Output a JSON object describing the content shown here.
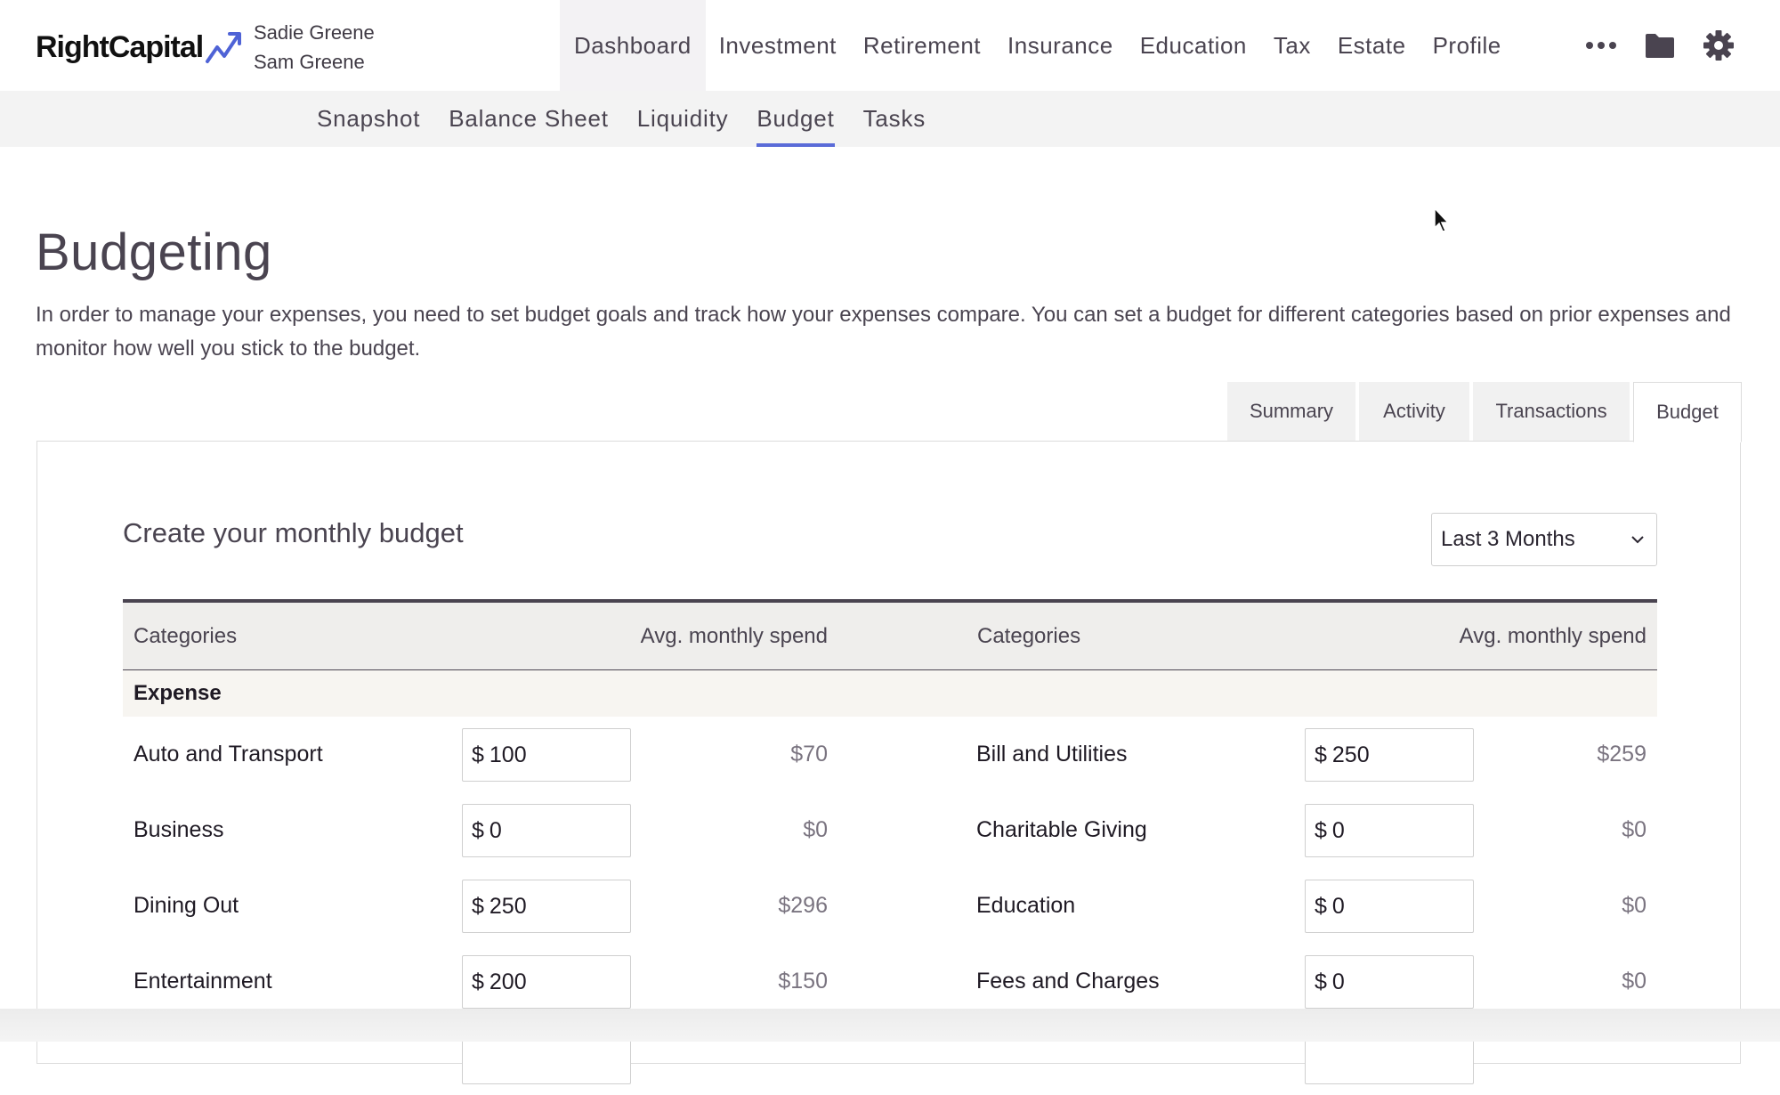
{
  "brand": {
    "name": "RightCapital"
  },
  "clients": [
    "Sadie Greene",
    "Sam Greene"
  ],
  "top_nav": {
    "items": [
      "Dashboard",
      "Investment",
      "Retirement",
      "Insurance",
      "Education",
      "Tax",
      "Estate",
      "Profile"
    ],
    "active": "Dashboard",
    "icons": [
      "more-icon",
      "folder-icon",
      "gear-icon"
    ]
  },
  "sub_nav": {
    "items": [
      "Snapshot",
      "Balance Sheet",
      "Liquidity",
      "Budget",
      "Tasks"
    ],
    "active": "Budget"
  },
  "page": {
    "title": "Budgeting",
    "description": "In order to manage your expenses, you need to set budget goals and track how your expenses compare. You can set a budget for different categories based on prior expenses and monitor how well you stick to the budget."
  },
  "tabs": {
    "items": [
      "Summary",
      "Activity",
      "Transactions",
      "Budget"
    ],
    "active": "Budget"
  },
  "panel": {
    "title": "Create your monthly budget",
    "period_select": "Last 3 Months"
  },
  "table": {
    "headers": [
      "Categories",
      "Avg. monthly spend",
      "Categories",
      "Avg. monthly spend"
    ],
    "group": "Expense",
    "currency": "$",
    "rows": [
      {
        "left": {
          "category": "Auto and Transport",
          "budget": "100",
          "avg": "$70"
        },
        "right": {
          "category": "Bill and Utilities",
          "budget": "250",
          "avg": "$259"
        }
      },
      {
        "left": {
          "category": "Business",
          "budget": "0",
          "avg": "$0"
        },
        "right": {
          "category": "Charitable Giving",
          "budget": "0",
          "avg": "$0"
        }
      },
      {
        "left": {
          "category": "Dining Out",
          "budget": "250",
          "avg": "$296"
        },
        "right": {
          "category": "Education",
          "budget": "0",
          "avg": "$0"
        }
      },
      {
        "left": {
          "category": "Entertainment",
          "budget": "200",
          "avg": "$150"
        },
        "right": {
          "category": "Fees and Charges",
          "budget": "0",
          "avg": "$0"
        }
      }
    ]
  },
  "colors": {
    "accent": "#5a6bd8",
    "text": "#4a4450",
    "header_bg": "#efeeec"
  }
}
